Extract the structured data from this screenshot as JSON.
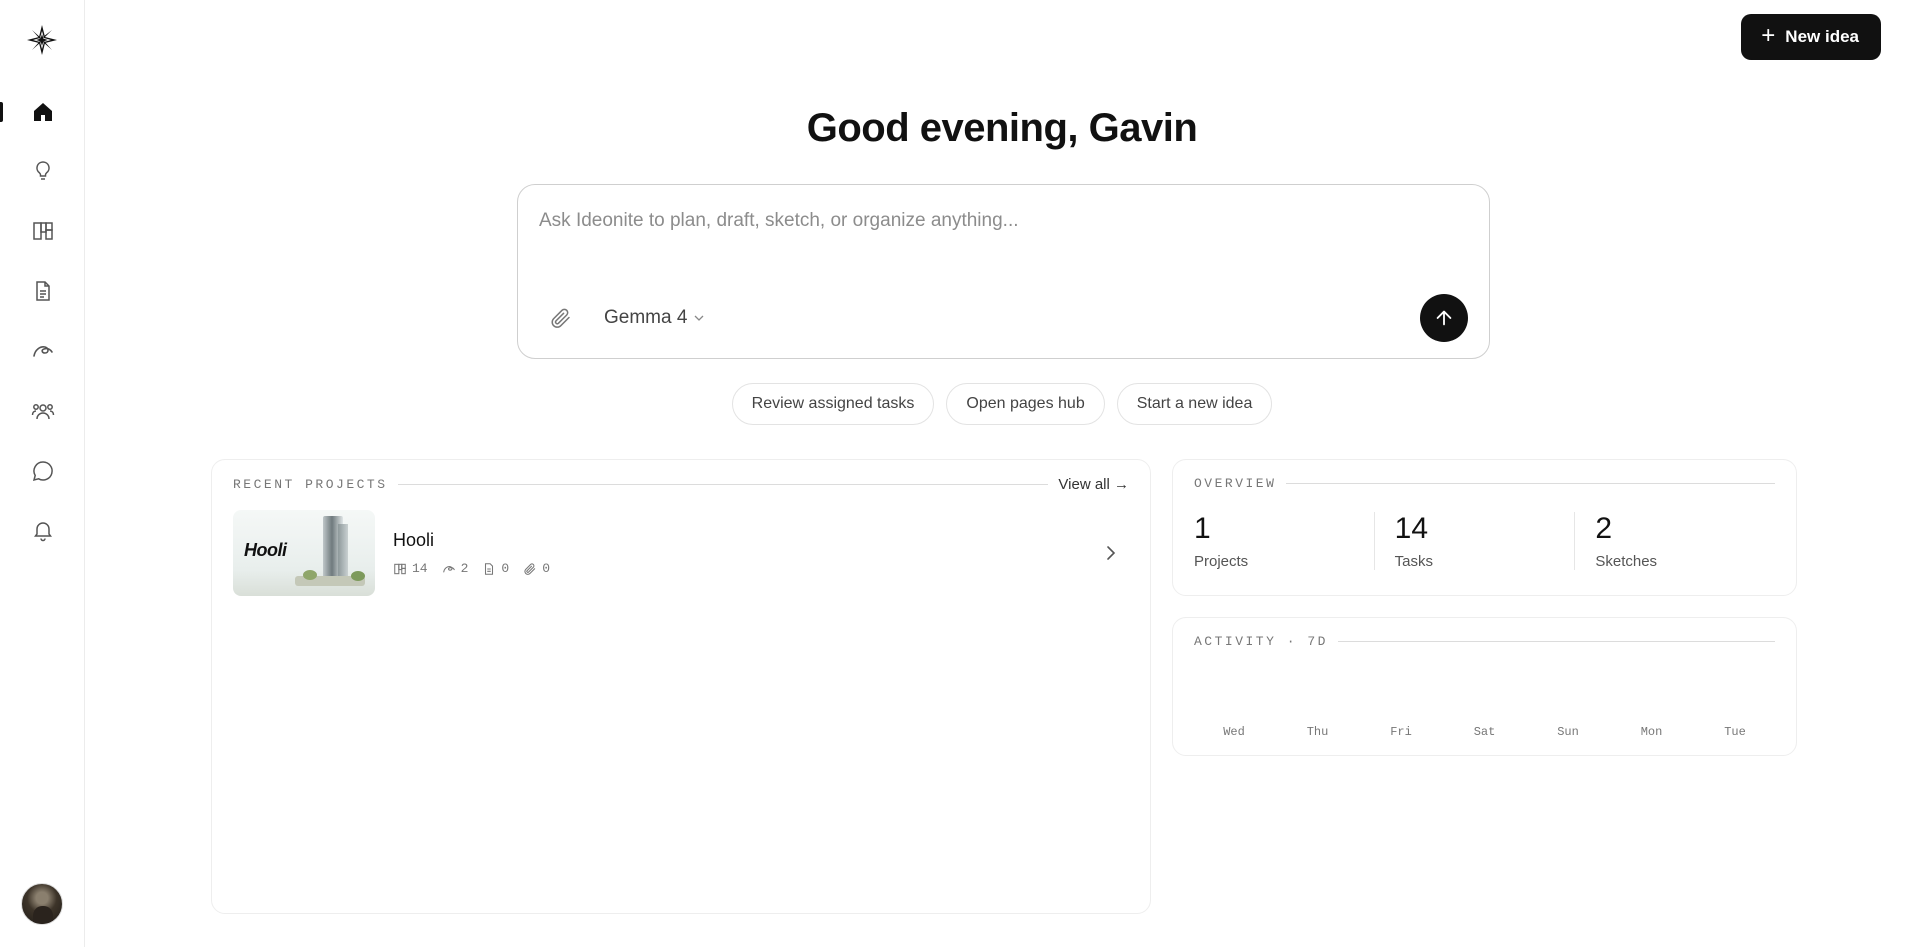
{
  "sidebar": {
    "logo": "compass-star-logo",
    "items": [
      {
        "name": "home",
        "icon": "home-icon",
        "active": true
      },
      {
        "name": "ideas",
        "icon": "lightbulb-icon",
        "active": false
      },
      {
        "name": "boards",
        "icon": "board-icon",
        "active": false
      },
      {
        "name": "pages",
        "icon": "document-icon",
        "active": false
      },
      {
        "name": "sketches",
        "icon": "squiggle-icon",
        "active": false
      },
      {
        "name": "team",
        "icon": "team-icon",
        "active": false
      },
      {
        "name": "chat",
        "icon": "chat-bubble-icon",
        "active": false
      },
      {
        "name": "notifications",
        "icon": "bell-icon",
        "active": false
      }
    ],
    "avatar": "user-avatar"
  },
  "header": {
    "new_idea_label": "New idea"
  },
  "greeting": "Good evening, Gavin",
  "prompt": {
    "placeholder": "Ask Ideonite to plan, draft, sketch, or organize anything...",
    "value": "",
    "model": "Gemma 4"
  },
  "suggestions": [
    "Review assigned tasks",
    "Open pages hub",
    "Start a new idea"
  ],
  "recent_projects": {
    "label": "RECENT PROJECTS",
    "view_all": "View all →",
    "projects": [
      {
        "name": "Hooli",
        "thumbnail_text": "Hooli",
        "tasks": "14",
        "sketches": "2",
        "pages": "0",
        "files": "0"
      }
    ]
  },
  "overview": {
    "label": "OVERVIEW",
    "stats": [
      {
        "value": "1",
        "label": "Projects"
      },
      {
        "value": "14",
        "label": "Tasks"
      },
      {
        "value": "2",
        "label": "Sketches"
      }
    ]
  },
  "activity": {
    "label": "ACTIVITY · 7D",
    "days": [
      "Wed",
      "Thu",
      "Fri",
      "Sat",
      "Sun",
      "Mon",
      "Tue"
    ]
  }
}
